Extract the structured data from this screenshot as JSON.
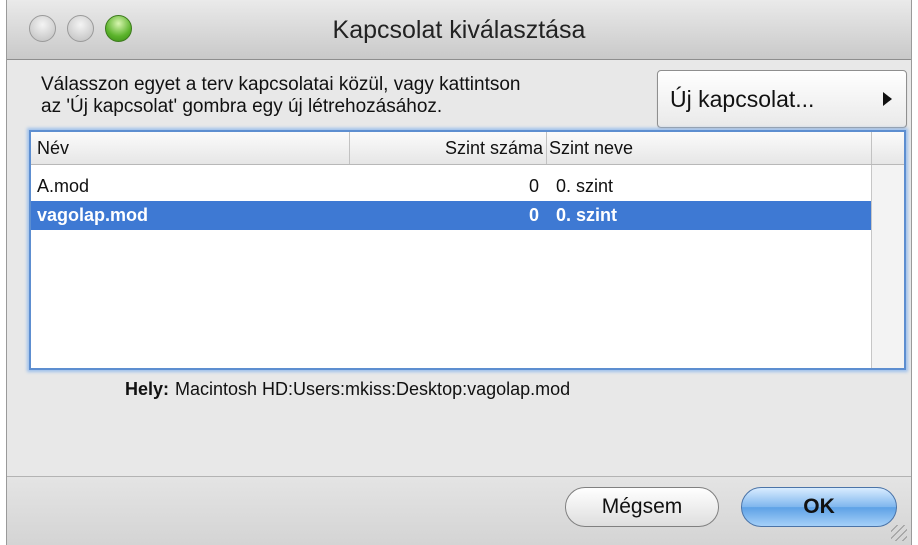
{
  "window": {
    "title": "Kapcsolat kiválasztása"
  },
  "instructions": {
    "line1": "Válasszon egyet a terv kapcsolatai közül, vagy kattintson",
    "line2": "az 'Új kapcsolat' gombra egy új létrehozásához."
  },
  "new_connection_button": {
    "label": "Új kapcsolat..."
  },
  "table": {
    "columns": [
      "Név",
      "Szint száma",
      "Szint neve"
    ],
    "rows": [
      {
        "name": "A.mod",
        "level_number": "0",
        "level_name": "0. szint",
        "selected": false
      },
      {
        "name": "vagolap.mod",
        "level_number": "0",
        "level_name": "0. szint",
        "selected": true
      }
    ]
  },
  "location": {
    "label": "Hely:",
    "value": "Macintosh HD:Users:mkiss:Desktop:vagolap.mod"
  },
  "buttons": {
    "cancel": "Mégsem",
    "ok": "OK"
  },
  "colors": {
    "selection": "#3e79d3",
    "focus_ring": "#5d8ed0",
    "zoom_button": "#5bb32b"
  }
}
